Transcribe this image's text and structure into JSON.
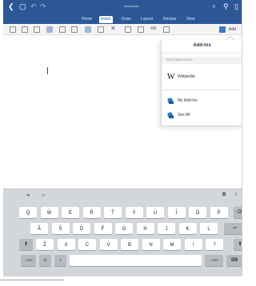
{
  "titlebar": {
    "doc_title": "Document"
  },
  "tabs": [
    {
      "label": "Home",
      "active": false
    },
    {
      "label": "Insert",
      "active": true
    },
    {
      "label": "Draw",
      "active": false
    },
    {
      "label": "Layout",
      "active": false
    },
    {
      "label": "Review",
      "active": false
    },
    {
      "label": "View",
      "active": false
    }
  ],
  "ribbon": {
    "symbol_label": "π",
    "textstyle_label": "Ab",
    "addins_label": "Add"
  },
  "popover": {
    "title": "Add-ins",
    "section_label": "RECOMMENDED",
    "wikipedia_label": "Wikipedia",
    "my_addins_label": "My Add-ins",
    "see_all_label": "See All"
  },
  "keyboard": {
    "bold_label": "B",
    "italic_label": "I",
    "row1": [
      {
        "main": "Q",
        "sub": "1"
      },
      {
        "main": "W",
        "sub": "2"
      },
      {
        "main": "E",
        "sub": "3"
      },
      {
        "main": "R",
        "sub": "4"
      },
      {
        "main": "T",
        "sub": "5"
      },
      {
        "main": "Y",
        "sub": "6"
      },
      {
        "main": "U",
        "sub": "7"
      },
      {
        "main": "I",
        "sub": "8"
      },
      {
        "main": "O",
        "sub": "9"
      },
      {
        "main": "P",
        "sub": "0"
      }
    ],
    "row2": [
      {
        "main": "A",
        "sub": "@"
      },
      {
        "main": "S",
        "sub": "#"
      },
      {
        "main": "D",
        "sub": "$"
      },
      {
        "main": "F",
        "sub": "&"
      },
      {
        "main": "G",
        "sub": "*"
      },
      {
        "main": "H",
        "sub": "("
      },
      {
        "main": "J",
        "sub": ")"
      },
      {
        "main": "K",
        "sub": "'"
      },
      {
        "main": "L",
        "sub": "\""
      }
    ],
    "row3": [
      {
        "main": "Z",
        "sub": "%"
      },
      {
        "main": "X",
        "sub": "-"
      },
      {
        "main": "C",
        "sub": "+"
      },
      {
        "main": "V",
        "sub": "="
      },
      {
        "main": "B",
        "sub": "/"
      },
      {
        "main": "N",
        "sub": ";"
      },
      {
        "main": "M",
        "sub": ":"
      },
      {
        "main": "!",
        "sub": ","
      },
      {
        "main": "?",
        "sub": "."
      }
    ],
    "numbers_label": ".?123",
    "numbers_label_right": ".?123"
  }
}
